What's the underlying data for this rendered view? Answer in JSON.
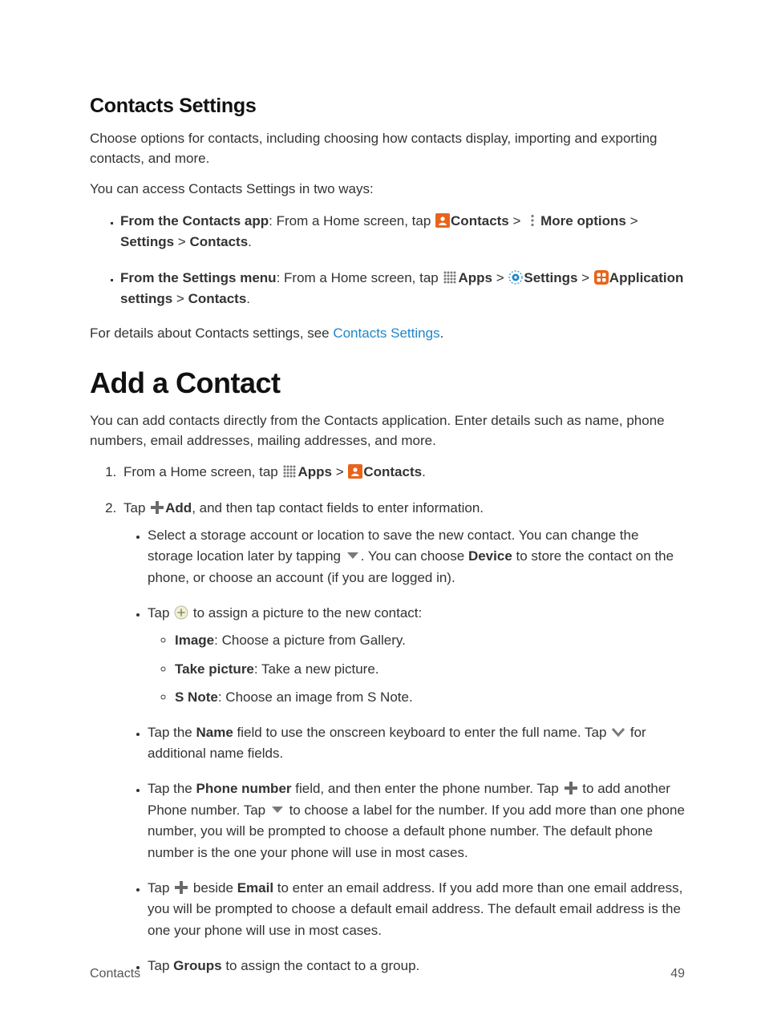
{
  "h_contacts_settings": "Contacts Settings",
  "p_intro": "Choose options for contacts, including choosing how contacts display, importing and exporting contacts, and more.",
  "p_twoways": "You can access Contacts Settings in two ways:",
  "b1_lead_bold": "From the Contacts app",
  "b1_1": ": From a Home screen, tap ",
  "lbl_contacts": "Contacts",
  "sep_gt": " > ",
  "lbl_more_options": "More options",
  "lbl_settings": "Settings",
  "period": ".",
  "b2_lead_bold": "From the Settings menu",
  "b2_1": ": From a Home screen, tap ",
  "lbl_apps": "Apps",
  "lbl_app_settings": "Application settings",
  "p_details_1": "For details about Contacts settings, see ",
  "link_contacts_settings": "Contacts Settings",
  "h_add_contact": "Add a Contact",
  "p_addintro": "You can add contacts directly from the Contacts application. Enter details such as name, phone numbers, email addresses, mailing addresses, and more.",
  "s1_1": "From a Home screen, tap ",
  "s2_tap": "Tap ",
  "lbl_add": "Add",
  "s2_2": ", and then tap contact fields to enter information.",
  "sb_storage_1": "Select a storage account or location to save the new contact. You can change the storage location later by tapping ",
  "sb_storage_2": ". You can choose ",
  "lbl_device": "Device",
  "sb_storage_3": " to store the contact on the phone, or choose an account (if you are logged in).",
  "sb_pic_2": " to assign a picture to the new contact:",
  "lbl_image": "Image",
  "img_desc": ": Choose a picture from Gallery.",
  "lbl_takepic": "Take picture",
  "takepic_desc": ": Take a new picture.",
  "lbl_snote": "S Note",
  "snote_desc": ": Choose an image from S Note.",
  "sb_name_1": "Tap the ",
  "lbl_name": "Name",
  "sb_name_2": " field to use the onscreen keyboard to enter the full name. Tap ",
  "sb_name_3": " for additional name fields.",
  "lbl_phone": "Phone number",
  "sb_phone_2": " field, and then enter the phone number. Tap ",
  "sb_phone_3": " to add another Phone number. Tap ",
  "sb_phone_4": " to choose a label for the number. If you add more than one phone number, you will be prompted to choose a default phone number. The default phone number is the one your phone will use in most cases.",
  "sb_email_2": " beside ",
  "lbl_email": "Email",
  "sb_email_3": " to enter an email address. If you add more than one email address, you will be prompted to choose a default email address. The default email address is the one your phone will use in most cases.",
  "lbl_groups": "Groups",
  "sb_groups_2": " to assign the contact to a group.",
  "footer_left": "Contacts",
  "footer_right": "49"
}
